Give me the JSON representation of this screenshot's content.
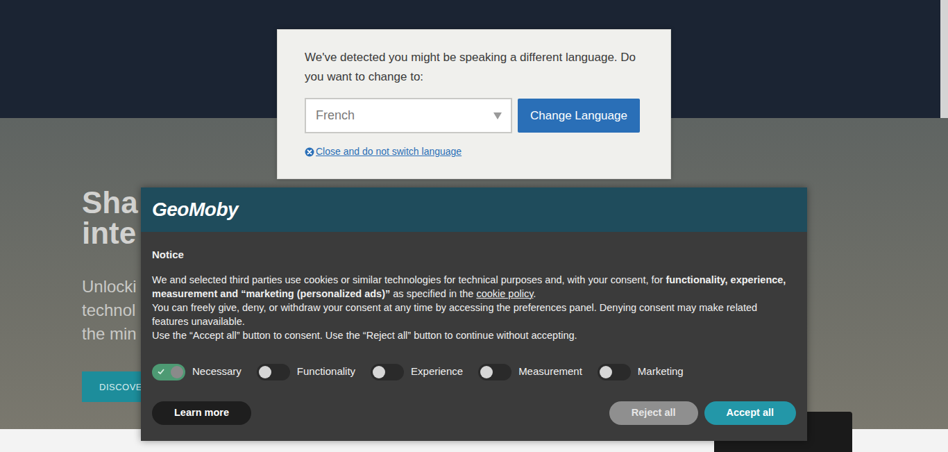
{
  "hero": {
    "title_lines": [
      "Sha",
      "inte"
    ],
    "subtitle_lines": [
      "Unlocki",
      "technol",
      "the min"
    ],
    "button": "DISCOVE"
  },
  "language_popup": {
    "message": "We've detected you might be speaking a different language. Do you want to change to:",
    "select_value": "French",
    "button": "Change Language",
    "close_link": "Close and do not switch language"
  },
  "cookie_banner": {
    "logo": "GeoMoby",
    "heading": "Notice",
    "paragraph1": [
      {
        "text": "We and selected third parties use cookies or similar technologies for technical purposes and, with your consent, for ",
        "kind": "plain"
      },
      {
        "text": "functionality, experience, measurement and “marketing (personalized ads)”",
        "kind": "bold"
      },
      {
        "text": " as specified in the ",
        "kind": "plain"
      },
      {
        "text": "cookie policy",
        "kind": "link"
      },
      {
        "text": ".",
        "kind": "plain"
      }
    ],
    "paragraph2": "You can freely give, deny, or withdraw your consent at any time by accessing the preferences panel. Denying consent may make related features unavailable.",
    "paragraph3": "Use the “Accept all” button to consent. Use the “Reject all” button to continue without accepting.",
    "toggles": [
      {
        "label": "Necessary",
        "on": true
      },
      {
        "label": "Functionality",
        "on": false
      },
      {
        "label": "Experience",
        "on": false
      },
      {
        "label": "Measurement",
        "on": false
      },
      {
        "label": "Marketing",
        "on": false
      }
    ],
    "buttons": [
      {
        "label": "Learn more",
        "kind": "learn"
      },
      {
        "label": "Reject all",
        "kind": "reject"
      },
      {
        "label": "Accept all",
        "kind": "accept"
      }
    ]
  }
}
